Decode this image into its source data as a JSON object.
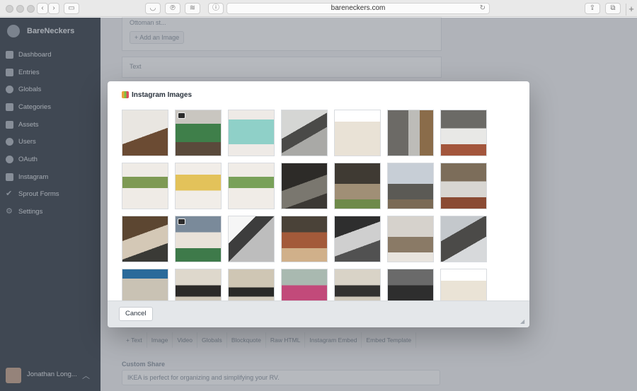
{
  "browser": {
    "url": "bareneckers.com",
    "plus": "+"
  },
  "sidebar": {
    "site_name": "BareNeckers",
    "items": [
      {
        "label": "Dashboard",
        "icon": "gauge-icon"
      },
      {
        "label": "Entries",
        "icon": "entries-icon"
      },
      {
        "label": "Globals",
        "icon": "globe-icon"
      },
      {
        "label": "Categories",
        "icon": "categories-icon"
      },
      {
        "label": "Assets",
        "icon": "assets-icon"
      },
      {
        "label": "Users",
        "icon": "users-icon"
      },
      {
        "label": "OAuth",
        "icon": "oauth-icon"
      },
      {
        "label": "Instagram",
        "icon": "instagram-icon"
      },
      {
        "label": "Sprout Forms",
        "icon": "check-icon"
      },
      {
        "label": "Settings",
        "icon": "gear-icon"
      }
    ],
    "user_name": "Jonathan Long...",
    "caret": "︿"
  },
  "background": {
    "asset_name": "Ottoman st...",
    "add_image": "+ Add an Image",
    "text_block": "Text",
    "toolbar": [
      "+ Text",
      "Image",
      "Video",
      "Globals",
      "Blockquote",
      "Raw HTML",
      "Instagram Embed",
      "Embed Template"
    ],
    "custom_share_label": "Custom Share",
    "custom_share_value": "IKEA is perfect for organizing and simplifying your RV."
  },
  "modal": {
    "title": "Instagram Images",
    "cancel_label": "Cancel",
    "images": [
      {
        "bg": "linear-gradient(160deg,#e9e6e1 0 55%,#6b4b33 55%)",
        "video": false
      },
      {
        "bg": "linear-gradient(180deg,#c9c6c0 0 30%,#3f7f4a 30% 70%,#5a4a3b 70%)",
        "video": true
      },
      {
        "bg": "linear-gradient(180deg,#eeeae6 0 20%,#8fd0c8 20% 75%,#eeeae6 75%)",
        "video": false
      },
      {
        "bg": "linear-gradient(150deg,#d5d6d4 0 40%,#4a4a48 40% 60%,#a9a9a6 60%)",
        "video": false
      },
      {
        "bg": "linear-gradient(180deg,#ffffff 0 25%,#e9e2d6 25% 100%)",
        "video": false
      },
      {
        "bg": "linear-gradient(90deg,#6c6a66 0 45%,#bdbcb8 45% 70%,#8a6c4a 70%)",
        "video": false
      },
      {
        "bg": "linear-gradient(180deg,#6b6a66 0 40%,#e8e8e6 40% 75%,#a3563c 75%)",
        "video": false
      },
      {
        "bg": "linear-gradient(180deg,#efebe6 0 30%,#7e9a54 30% 55%,#efebe6 55%)",
        "video": false
      },
      {
        "bg": "linear-gradient(180deg,#f1ede8 0 25%,#e3c25a 25% 60%,#f1ede8 60%)",
        "video": false
      },
      {
        "bg": "linear-gradient(180deg,#f0ece7 0 30%,#79a159 30% 55%,#f0ece7 55%)",
        "video": false
      },
      {
        "bg": "linear-gradient(160deg,#2d2b28 0 45%,#7a776f 45% 75%,#3b3834 75%)",
        "video": false
      },
      {
        "bg": "linear-gradient(180deg,#3f3a33 0 45%,#a08f76 45% 80%,#6e8a4a 80%)",
        "video": false
      },
      {
        "bg": "linear-gradient(180deg,#c7ced6 0 45%,#5b5a55 45% 80%,#7a6a55 80%)",
        "video": false
      },
      {
        "bg": "linear-gradient(180deg,#7c6d5a 0 40%,#d8d6d2 40% 75%,#8a4a33 75%)",
        "video": false
      },
      {
        "bg": "linear-gradient(160deg,#5c4631 0 40%,#d4c8b6 40% 70%,#3a3a36 70%)",
        "video": false
      },
      {
        "bg": "linear-gradient(180deg,#7a8a9a 0 35%,#e9e2d9 35% 70%,#3e7a4a 70%)",
        "video": true
      },
      {
        "bg": "linear-gradient(135deg,#f6f6f6 0 30%,#3d3d3d 30% 50%,#bdbdbd 50%)",
        "video": false
      },
      {
        "bg": "linear-gradient(180deg,#4a4238 0 35%,#a35a3a 35% 70%,#d0b08a 70%)",
        "video": false
      },
      {
        "bg": "linear-gradient(160deg,#2e2e2e 0 35%,#cfcfcf 35% 65%,#515151 65%)",
        "video": false
      },
      {
        "bg": "linear-gradient(180deg,#d6d2cc 0 45%,#8a7a66 45% 80%,#e8e4de 80%)",
        "video": false
      },
      {
        "bg": "linear-gradient(150deg,#c4c8cc 0 35%,#4b4a48 35% 65%,#d7d9db 65%)",
        "video": false
      },
      {
        "bg": "linear-gradient(180deg,#2a6a9a 0 20%,#c9c2b4 20% 70%,#eae6de 70%)",
        "video": false
      },
      {
        "bg": "linear-gradient(180deg,#ded8cc 0 35%,#2c2a28 35% 60%,#cfc7b8 60%)",
        "video": false
      },
      {
        "bg": "linear-gradient(180deg,#cfc6b4 0 40%,#2a2a28 40% 60%,#d4cdbf 60%)",
        "video": false
      },
      {
        "bg": "linear-gradient(180deg,#a9b9b0 0 35%,#c24a7a 35% 70%,#5c7a4a 70%)",
        "video": false
      },
      {
        "bg": "linear-gradient(180deg,#d9d3c7 0 35%,#333230 35% 60%,#d0c9bb 60%)",
        "video": false
      },
      {
        "bg": "linear-gradient(180deg,#6a6a6a 0 35%,#2e2e2e 35% 70%,#b9b3a8 70%)",
        "video": false
      },
      {
        "bg": "linear-gradient(180deg,#ffffff 0 25%,#eae3d6 25% 70%,#a43a3a 70%)",
        "video": false
      }
    ]
  }
}
